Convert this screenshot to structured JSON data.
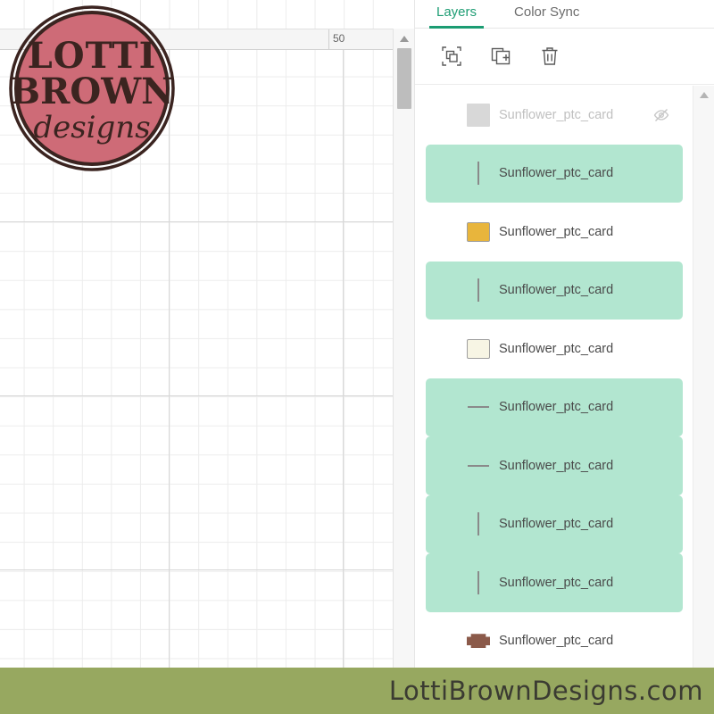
{
  "app": {
    "footer_site": "LottiBrownDesigns.com"
  },
  "logo": {
    "line1": "LOTTI",
    "line2": "BROWN",
    "line3": "designs",
    "circle_color": "#ce6b77",
    "text_color": "#3b2420"
  },
  "canvas": {
    "ruler_label_50": "50",
    "grid_on": true
  },
  "panel": {
    "tabs": [
      {
        "label": "Layers",
        "active": true
      },
      {
        "label": "Color Sync",
        "active": false
      }
    ],
    "toolbar": [
      {
        "name": "group-icon",
        "title": "Group"
      },
      {
        "name": "duplicate-icon",
        "title": "Duplicate"
      },
      {
        "name": "delete-icon",
        "title": "Delete"
      }
    ],
    "layers": [
      {
        "name": "Sunflower_ptc_card",
        "thumb": "plain-grey",
        "selected": false,
        "hidden": true,
        "color": "#d8d8d8"
      },
      {
        "name": "Sunflower_ptc_card",
        "thumb": "vbar",
        "selected": true,
        "hidden": false,
        "color": "#8a8a8a"
      },
      {
        "name": "Sunflower_ptc_card",
        "thumb": "box-fill",
        "selected": false,
        "hidden": false,
        "color": "#e8b53c"
      },
      {
        "name": "Sunflower_ptc_card",
        "thumb": "vbar",
        "selected": true,
        "hidden": false,
        "color": "#8a8a8a"
      },
      {
        "name": "Sunflower_ptc_card",
        "thumb": "box-fill",
        "selected": false,
        "hidden": false,
        "color": "#f7f5e4"
      },
      {
        "name": "Sunflower_ptc_card",
        "thumb": "hline",
        "selected": true,
        "hidden": false,
        "color": "#8a8a8a"
      },
      {
        "name": "Sunflower_ptc_card",
        "thumb": "hline",
        "selected": true,
        "hidden": false,
        "color": "#8a8a8a"
      },
      {
        "name": "Sunflower_ptc_card",
        "thumb": "vbar",
        "selected": true,
        "hidden": false,
        "color": "#8a8a8a"
      },
      {
        "name": "Sunflower_ptc_card",
        "thumb": "vbar",
        "selected": true,
        "hidden": false,
        "color": "#8a8a8a"
      },
      {
        "name": "Sunflower_ptc_card",
        "thumb": "blob",
        "selected": false,
        "hidden": false,
        "color": "#8b5a4a"
      }
    ]
  },
  "colors": {
    "accent_teal": "#1b9c72",
    "selected_row": "#b2e6d0",
    "footer_green": "#97a860"
  }
}
